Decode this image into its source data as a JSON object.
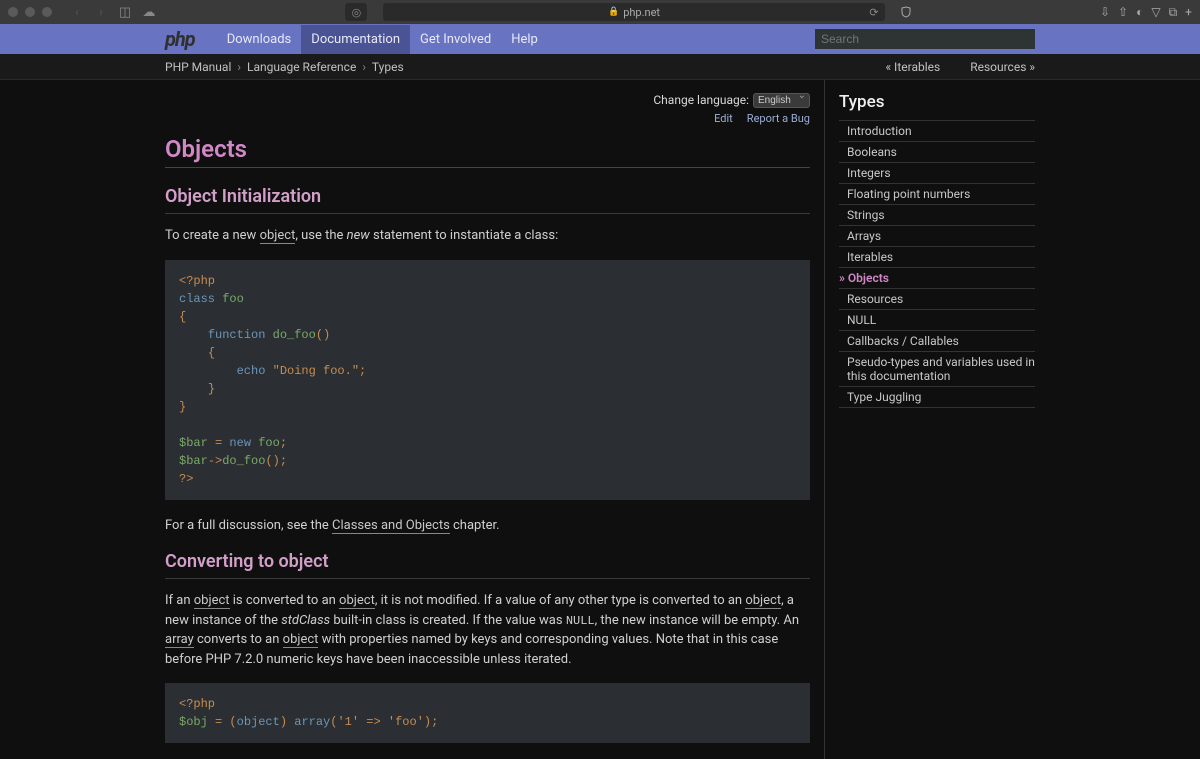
{
  "browser": {
    "url_host": "php.net"
  },
  "header": {
    "logo": "php",
    "nav": {
      "downloads": "Downloads",
      "documentation": "Documentation",
      "get_involved": "Get Involved",
      "help": "Help"
    },
    "search_placeholder": "Search"
  },
  "breadcrumb": {
    "manual": "PHP Manual",
    "langref": "Language Reference",
    "types": "Types",
    "prev": "« Iterables",
    "next": "Resources »"
  },
  "lang": {
    "label": "Change language:",
    "selected": "English",
    "edit": "Edit",
    "report": "Report a Bug"
  },
  "title": "Objects",
  "sec1": {
    "heading": "Object Initialization",
    "p1_a": "To create a new ",
    "p1_link": "object",
    "p1_b": ", use the ",
    "p1_em": "new",
    "p1_c": " statement to instantiate a class:",
    "p2_a": "For a full discussion, see the ",
    "p2_link": "Classes and Objects",
    "p2_b": " chapter."
  },
  "sec2": {
    "heading": "Converting to object",
    "text": {
      "p1": "If an ",
      "l1": "object",
      "p2": " is converted to an ",
      "l2": "object",
      "p3": ", it is not modified. If a value of any other type is converted to an ",
      "l3": "object",
      "p4": ", a new instance of the ",
      "em1": "stdClass",
      "p5": " built-in class is created. If the value was ",
      "lit1": "NULL",
      "p6": ", the new instance will be empty. An ",
      "l4": "array",
      "p7": " converts to an ",
      "l5": "object",
      "p8": " with properties named by keys and corresponding values. Note that in this case before PHP 7.2.0 numeric keys have been inaccessible unless iterated."
    }
  },
  "code1": {
    "open": "<?php",
    "class_kw": "class ",
    "class_name": "foo",
    "brace_o": "{",
    "func_kw": "function ",
    "func_name": "do_foo",
    "parens": "()",
    "brace_o2": "{",
    "echo_kw": "echo ",
    "str": "\"Doing foo.\"",
    "semi": ";",
    "brace_c2": "}",
    "brace_c": "}",
    "var": "$bar ",
    "eq": "= ",
    "new_kw": "new ",
    "new_name": "foo",
    "semi2": ";",
    "var2": "$bar",
    "arrow": "->",
    "call": "do_foo",
    "call_end": "();",
    "close": "?>"
  },
  "code2": {
    "open": "<?php",
    "var": "$obj ",
    "eq": "= (",
    "cast": "object",
    "eq2": ") ",
    "arr_kw": "array",
    "paren": "(",
    "k": "'1' ",
    "arrow": "=> ",
    "v": "'foo'",
    "end": ");"
  },
  "sidebar": {
    "title": "Types",
    "items": [
      "Introduction",
      "Booleans",
      "Integers",
      "Floating point numbers",
      "Strings",
      "Arrays",
      "Iterables",
      "Objects",
      "Resources",
      "NULL",
      "Callbacks / Callables",
      "Pseudo-types and variables used in this documentation",
      "Type Juggling"
    ],
    "active_index": 7
  }
}
